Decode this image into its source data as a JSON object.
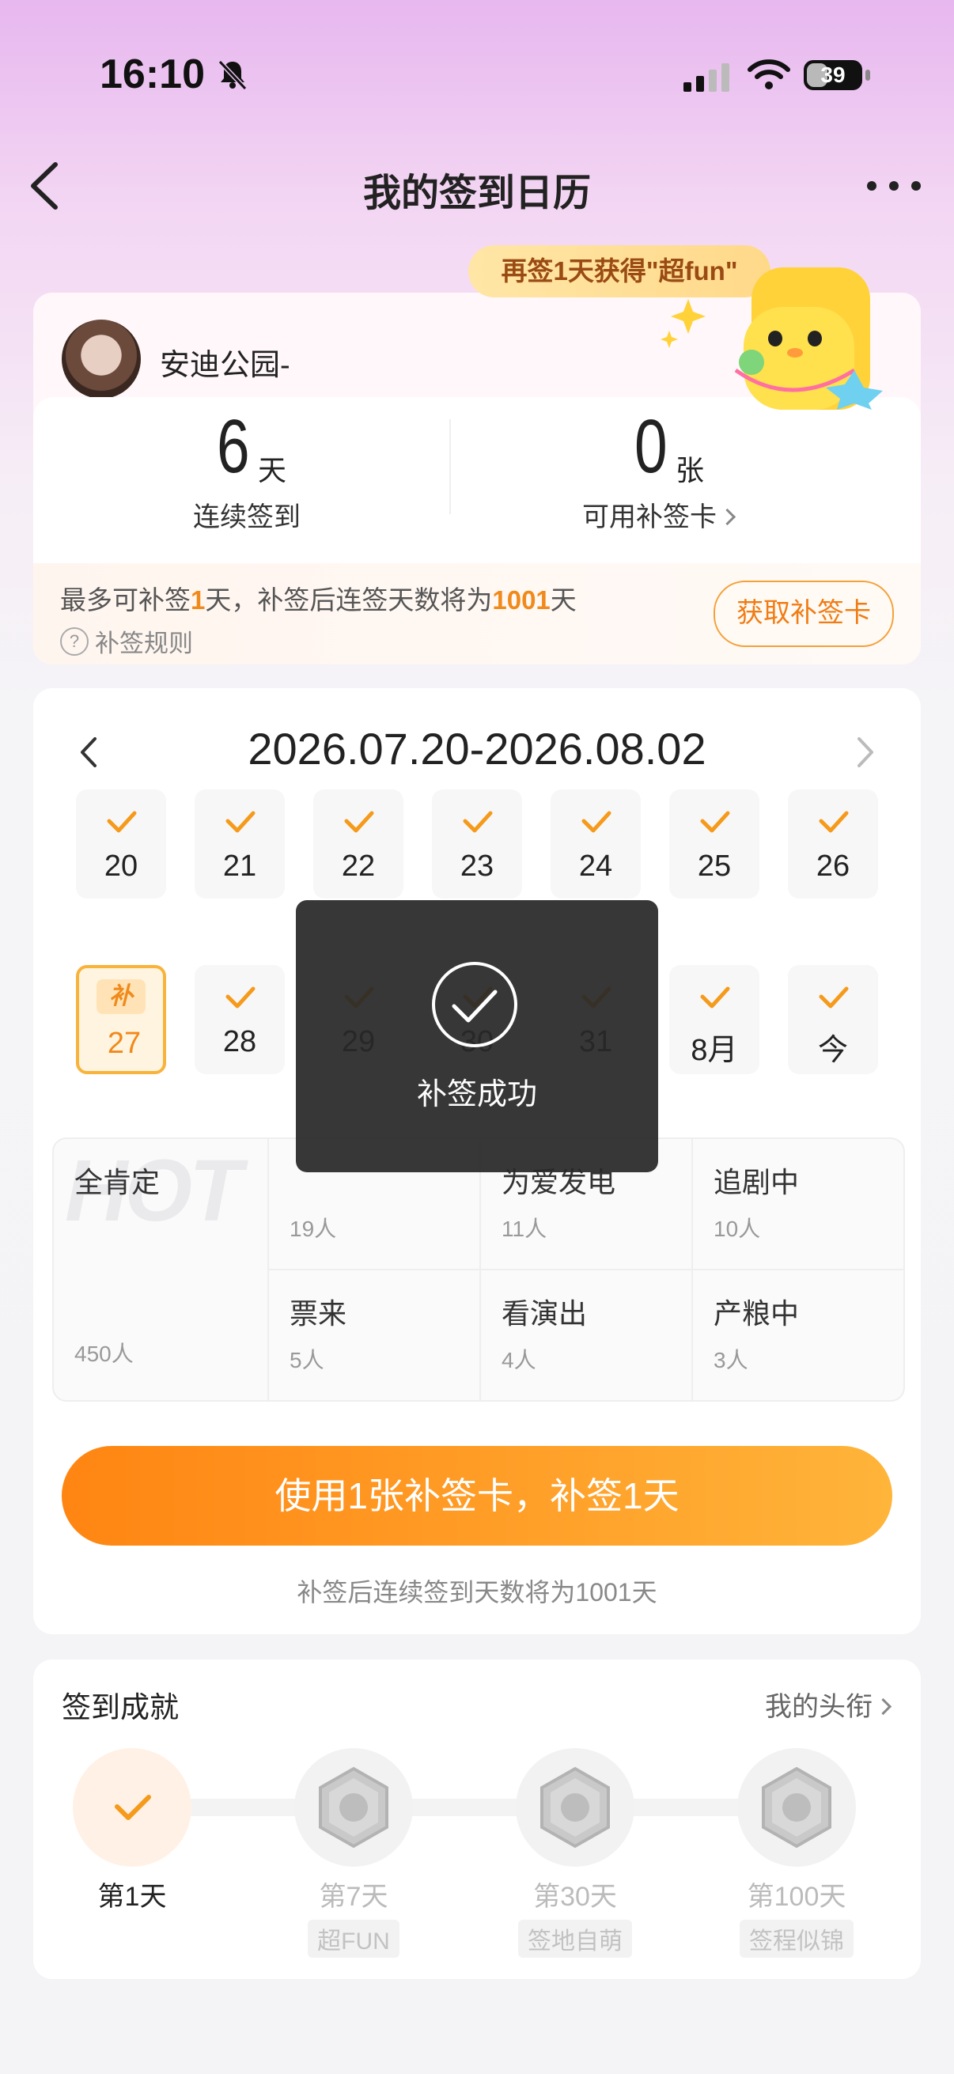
{
  "status_bar": {
    "time": "16:10",
    "battery": "39"
  },
  "nav": {
    "title": "我的签到日历"
  },
  "bubble": {
    "text": "再签1天获得\"超fun\""
  },
  "user": {
    "name": "安迪公园-",
    "streak_value": "6",
    "streak_unit": "天",
    "streak_label": "连续签到",
    "cards_value": "0",
    "cards_unit": "张",
    "cards_label": "可用补签卡"
  },
  "makeup": {
    "text_prefix": "最多可补签",
    "days": "1",
    "text_mid": "天，补签后连签天数将为",
    "total": "1001",
    "text_suffix": "天",
    "rule_label": "补签规则",
    "get_card_button": "获取补签卡"
  },
  "calendar": {
    "range": "2026.07.20-2026.08.02",
    "row1": [
      {
        "label": "20",
        "checked": true
      },
      {
        "label": "21",
        "checked": true
      },
      {
        "label": "22",
        "checked": true
      },
      {
        "label": "23",
        "checked": true
      },
      {
        "label": "24",
        "checked": true
      },
      {
        "label": "25",
        "checked": true
      },
      {
        "label": "26",
        "checked": true
      }
    ],
    "row2": [
      {
        "label": "27",
        "makeup": true,
        "badge": "补"
      },
      {
        "label": "28",
        "checked": true
      },
      {
        "label": "29",
        "checked": true
      },
      {
        "label": "30",
        "checked": true
      },
      {
        "label": "31",
        "checked": true
      },
      {
        "label": "8月",
        "checked": true
      },
      {
        "label": "今",
        "checked": true
      }
    ]
  },
  "tags": {
    "big": {
      "name": "全肯定",
      "count": "450人",
      "watermark": "HOT"
    },
    "items": [
      {
        "name": "",
        "count": "19人"
      },
      {
        "name": "为爱发电",
        "count": "11人"
      },
      {
        "name": "追剧中",
        "count": "10人"
      },
      {
        "name": "票来",
        "count": "5人"
      },
      {
        "name": "看演出",
        "count": "4人"
      },
      {
        "name": "产粮中",
        "count": "3人"
      }
    ]
  },
  "toast": {
    "text": "补签成功"
  },
  "action": {
    "button": "使用1张补签卡，补签1天",
    "sub": "补签后连续签到天数将为1001天"
  },
  "achievements": {
    "title": "签到成就",
    "link": "我的头衔",
    "items": [
      {
        "label": "第1天",
        "sub": "",
        "done": true
      },
      {
        "label": "第7天",
        "sub": "超FUN",
        "done": false
      },
      {
        "label": "第30天",
        "sub": "签地自萌",
        "done": false
      },
      {
        "label": "第100天",
        "sub": "签程似锦",
        "done": false
      }
    ]
  },
  "colors": {
    "accent": "#ff8a17",
    "check": "#f59a1a"
  }
}
